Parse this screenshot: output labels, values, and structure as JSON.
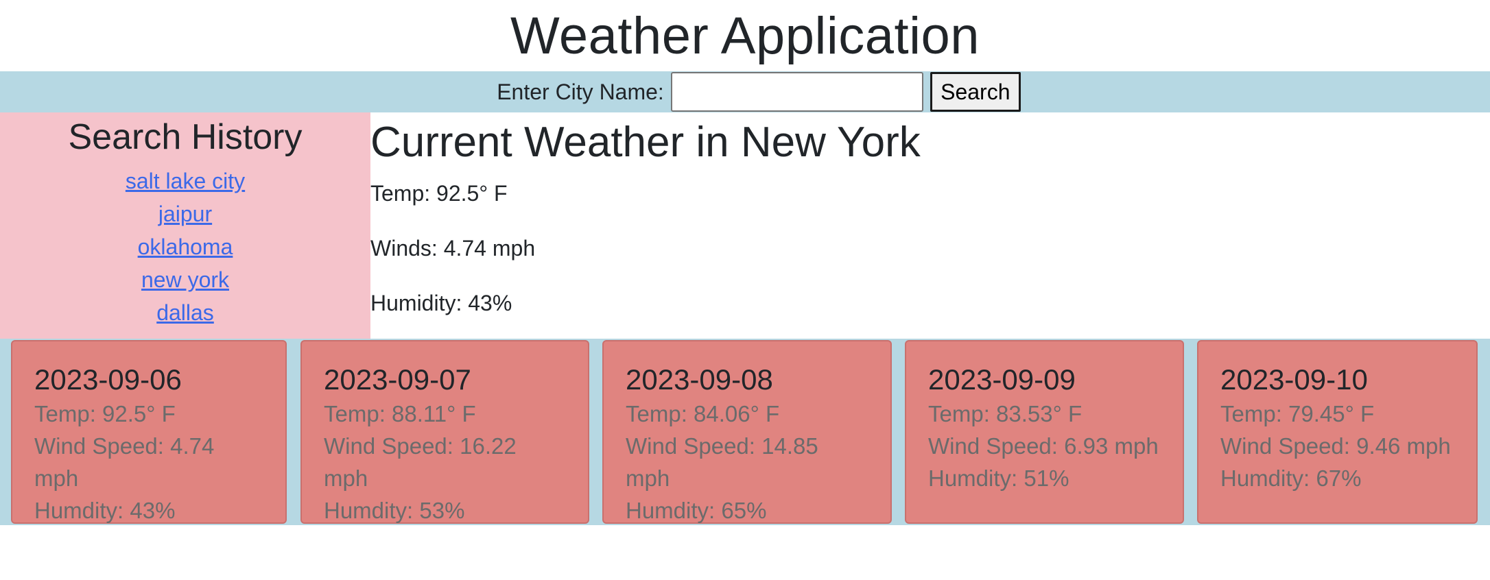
{
  "header": {
    "title": "Weather Application"
  },
  "search": {
    "label": "Enter City Name:",
    "value": "",
    "placeholder": "",
    "button_label": "Search"
  },
  "history": {
    "title": "Search History",
    "items": [
      "salt lake city",
      "jaipur",
      "oklahoma",
      "new york",
      "dallas"
    ]
  },
  "current": {
    "heading": "Current Weather in New York",
    "temp": "Temp: 92.5° F",
    "winds": "Winds: 4.74 mph",
    "humidity": "Humidity: 43%"
  },
  "forecast": [
    {
      "date": "2023-09-06",
      "temp": "Temp: 92.5° F",
      "wind": "Wind Speed: 4.74 mph",
      "humidity": "Humdity: 43%"
    },
    {
      "date": "2023-09-07",
      "temp": "Temp: 88.11° F",
      "wind": "Wind Speed: 16.22 mph",
      "humidity": "Humdity: 53%"
    },
    {
      "date": "2023-09-08",
      "temp": "Temp: 84.06° F",
      "wind": "Wind Speed: 14.85 mph",
      "humidity": "Humdity: 65%"
    },
    {
      "date": "2023-09-09",
      "temp": "Temp: 83.53° F",
      "wind": "Wind Speed: 6.93 mph",
      "humidity": "Humdity: 51%"
    },
    {
      "date": "2023-09-10",
      "temp": "Temp: 79.45° F",
      "wind": "Wind Speed: 9.46 mph",
      "humidity": "Humdity: 67%"
    }
  ],
  "colors": {
    "bar_bg": "#b6d8e3",
    "history_bg": "#f5c3cb",
    "card_bg": "#e08480",
    "link": "#3b69e8"
  }
}
